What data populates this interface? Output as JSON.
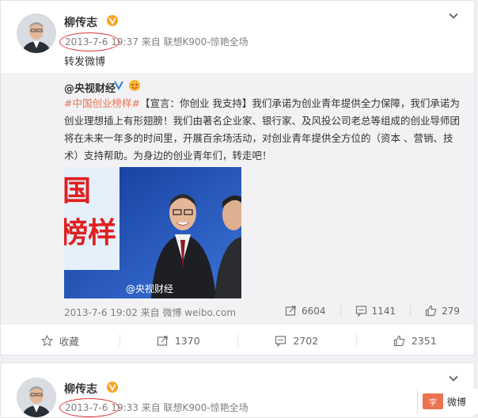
{
  "post": {
    "author": "柳传志",
    "date": "2013-7-6",
    "time_source": "19:37 来自 联想K900-惊艳全场",
    "text": "转发微博"
  },
  "repost": {
    "author": "@央视财经",
    "hashtag": "#中国创业榜样#",
    "body": "【宣言：你创业 我支持】我们承诺为创业青年提供全力保障，我们承诺为创业理想插上有形翅膀！我们由著名企业家、银行家、及风投公司老总等组成的创业导师团将在未来一年多的时间里，开展百余场活动，对创业青年提供全方位的（资本 、营销、技术）支持帮助。为身边的创业青年们，转走吧！",
    "image": {
      "banner_text": "国\n榜样",
      "watermark": "@央视财经"
    },
    "meta": "2013-7-6 19:02 来自 微博 weibo.com",
    "stats": {
      "reposts": "6604",
      "comments": "1141",
      "likes": "279"
    }
  },
  "actions": {
    "favorite": "收藏",
    "repost": "1370",
    "comment": "2702",
    "like": "2351"
  },
  "post2": {
    "author": "柳传志",
    "date": "2013-7-6",
    "time_source": "19:33 来自 联想K900-惊艳全场"
  },
  "overlay": {
    "label": "微博",
    "logo": "字"
  },
  "colors": {
    "tag": "#eb7350",
    "verified": "#f5a623",
    "circle": "#dd3333"
  }
}
